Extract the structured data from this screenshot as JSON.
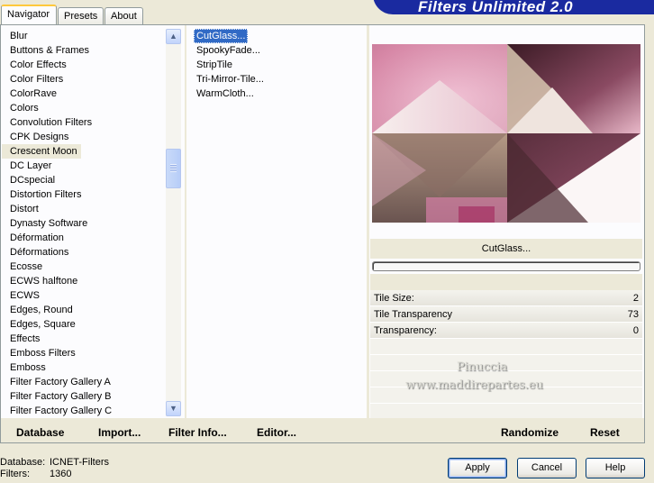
{
  "title": "Filters Unlimited 2.0",
  "tabs": [
    "Navigator",
    "Presets",
    "About"
  ],
  "categories": [
    "Blur",
    "Buttons & Frames",
    "Color Effects",
    "Color Filters",
    "ColorRave",
    "Colors",
    "Convolution Filters",
    "CPK Designs",
    "Crescent Moon",
    "DC Layer",
    "DCspecial",
    "Distortion Filters",
    "Distort",
    "Dynasty Software",
    "Déformation",
    "Déformations",
    "Ecosse",
    "ECWS halftone",
    "ECWS",
    "Edges, Round",
    "Edges, Square",
    "Effects",
    "Emboss Filters",
    "Emboss",
    "Filter Factory Gallery A",
    "Filter Factory Gallery B",
    "Filter Factory Gallery C"
  ],
  "selected_category": "Crescent Moon",
  "filters": [
    "CutGlass...",
    "SpookyFade...",
    "StripTile",
    "Tri-Mirror-Tile...",
    "WarmCloth..."
  ],
  "selected_filter": "CutGlass...",
  "filter_name": "CutGlass...",
  "params": [
    {
      "label": "Tile Size:",
      "value": "2"
    },
    {
      "label": "Tile Transparency",
      "value": "73"
    },
    {
      "label": "Transparency:",
      "value": "0"
    }
  ],
  "watermark": {
    "line1": "Pinuccia",
    "line2": "www.maddirepartes.eu"
  },
  "actions": {
    "database": "Database",
    "import": "Import...",
    "filter_info": "Filter Info...",
    "editor": "Editor...",
    "randomize": "Randomize",
    "reset": "Reset"
  },
  "footer": {
    "database_label": "Database:",
    "database_value": "ICNET-Filters",
    "filters_label": "Filters:",
    "filters_value": "1360"
  },
  "buttons": {
    "apply": "Apply",
    "cancel": "Cancel",
    "help": "Help"
  },
  "colors": {
    "accent": "#316ac5",
    "banner": "#1a2aa0",
    "tab_highlight": "#ffc83c"
  },
  "icons": {
    "scroll_up": "chevron-up-icon",
    "scroll_down": "chevron-down-icon"
  }
}
